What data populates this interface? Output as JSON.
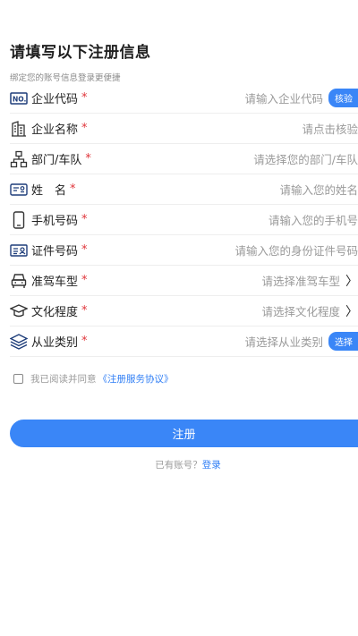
{
  "header": {
    "title": "请填写以下注册信息",
    "subtitle": "绑定您的账号信息登录更便捷"
  },
  "fields": [
    {
      "icon": "company-code-icon",
      "label": "企业代码",
      "required": "*",
      "placeholder": "请输入企业代码",
      "action": "核验"
    },
    {
      "icon": "building-icon",
      "label": "企业名称",
      "required": "*",
      "placeholder": "请点击核验"
    },
    {
      "icon": "org-chart-icon",
      "label": "部门/车队",
      "required": "*",
      "placeholder": "请选择您的部门/车队"
    },
    {
      "icon": "id-card-icon",
      "label": "姓　名",
      "required": "*",
      "placeholder": "请输入您的姓名"
    },
    {
      "icon": "mobile-phone-icon",
      "label": "手机号码",
      "required": "*",
      "placeholder": "请输入您的手机号"
    },
    {
      "icon": "certificate-icon",
      "label": "证件号码",
      "required": "*",
      "placeholder": "请输入您的身份证件号码"
    },
    {
      "icon": "car-icon",
      "label": "准驾车型",
      "required": "*",
      "placeholder": "请选择准驾车型",
      "chevron": "〉"
    },
    {
      "icon": "graduation-cap-icon",
      "label": "文化程度",
      "required": "*",
      "placeholder": "请选择文化程度",
      "chevron": "〉"
    },
    {
      "icon": "layers-icon",
      "label": "从业类别",
      "required": "*",
      "placeholder": "请选择从业类别",
      "action": "选择"
    }
  ],
  "agreement": {
    "text": "我已阅读并同意",
    "link": "《注册服务协议》"
  },
  "submit_label": "注册",
  "login": {
    "prompt": "已有账号？",
    "link": "登录"
  },
  "colors": {
    "accent": "#3a86f7",
    "required": "#e0353b",
    "placeholder": "#9a9a9a"
  }
}
